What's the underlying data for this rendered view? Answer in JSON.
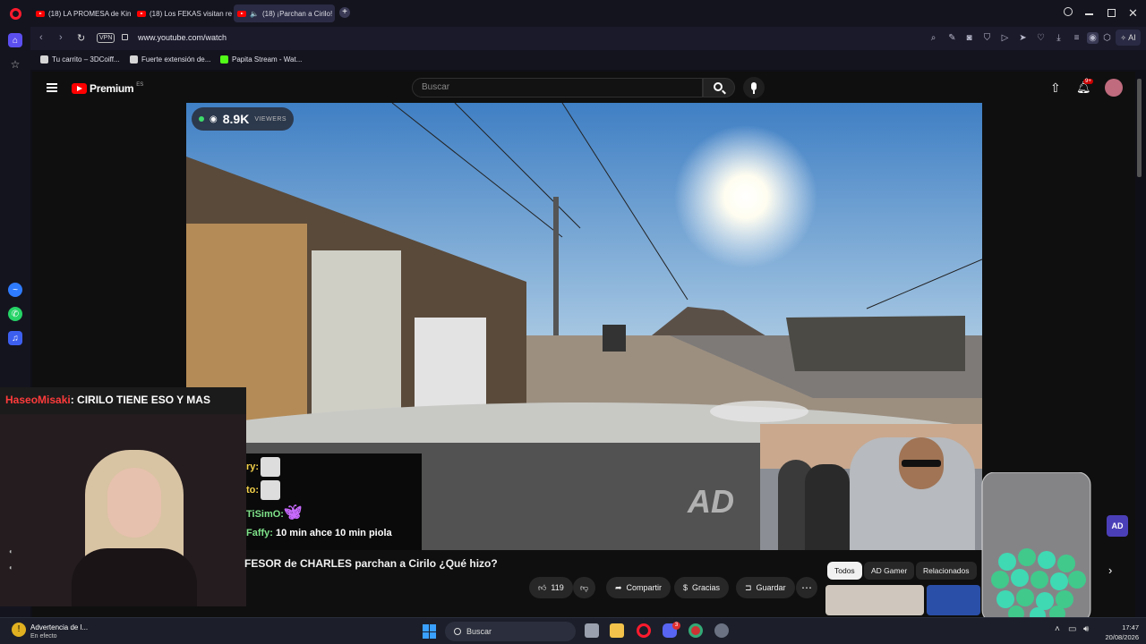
{
  "browser": {
    "tabs": [
      {
        "label": "(18) LA PROMESA de King"
      },
      {
        "label": "(18) Los FEKAS visitan res"
      },
      {
        "label": "(18) ¡Parchan a Cirilo!"
      }
    ],
    "vpn_label": "VPN",
    "url": "www.youtube.com/watch",
    "ai_label": "AI",
    "bookmarks": [
      {
        "label": "Tu carrito – 3DCoiff..."
      },
      {
        "label": "Fuerte extensión de..."
      },
      {
        "label": "Papita Stream - Wat..."
      }
    ],
    "accent": "#7b6cf6"
  },
  "youtube": {
    "logo_text": "Premium",
    "logo_region": "ES",
    "search_placeholder": "Buscar",
    "notif_badge": "9+",
    "brand_red": "#ff0000"
  },
  "stream": {
    "viewers_count": "8.9K",
    "viewers_label": "VIEWERS",
    "highlight_user": "HaseoMisaki",
    "highlight_text": ": CIRILO TIENE ESO Y MAS",
    "chat": [
      {
        "user": "ry:",
        "text": ""
      },
      {
        "user": "to:",
        "text": ""
      },
      {
        "user": "TiSimO:",
        "text": ""
      },
      {
        "user": "Faffy:",
        "text": "10 min ahce 10 min piola"
      }
    ],
    "watermark": "AD"
  },
  "video": {
    "title": "FESOR de CHARLES parchan a Cirilo ¿Qué hizo?",
    "actions": {
      "like_count": "119",
      "share": "Compartir",
      "thanks": "Gracias",
      "save": "Guardar"
    },
    "chips": [
      "Todos",
      "AD Gamer",
      "Relacionados"
    ]
  },
  "taskbar": {
    "notification_title": "Advertencia de l...",
    "notification_sub": "En efecto",
    "search_label": "Buscar",
    "time": "17:47",
    "date": "20/08/2026",
    "discord_badge": "3"
  }
}
